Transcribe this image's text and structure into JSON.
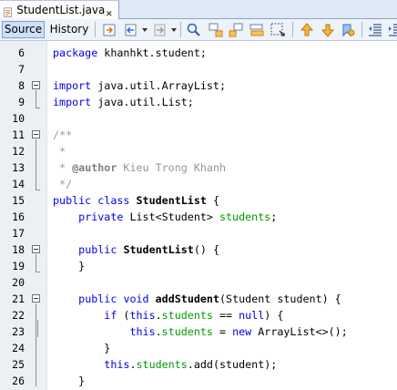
{
  "tab": {
    "filename": "StudentList.java"
  },
  "toolbar": {
    "source_label": "Source",
    "history_label": "History"
  },
  "colors": {
    "keyword": "#0000e6",
    "comment": "#969696",
    "field": "#009900"
  },
  "lines": [
    {
      "num": "6",
      "text": "package khanhkt.student;"
    },
    {
      "num": "7",
      "text": ""
    },
    {
      "num": "8",
      "text": "import java.util.ArrayList;"
    },
    {
      "num": "9",
      "text": "import java.util.List;"
    },
    {
      "num": "10",
      "text": ""
    },
    {
      "num": "11",
      "text": "/**"
    },
    {
      "num": "12",
      "text": " *"
    },
    {
      "num": "13",
      "text": " * @author Kieu Trong Khanh"
    },
    {
      "num": "14",
      "text": " */"
    },
    {
      "num": "15",
      "text": "public class StudentList {"
    },
    {
      "num": "16",
      "text": "    private List<Student> students;"
    },
    {
      "num": "17",
      "text": ""
    },
    {
      "num": "18",
      "text": "    public StudentList() {"
    },
    {
      "num": "19",
      "text": "    }"
    },
    {
      "num": "20",
      "text": ""
    },
    {
      "num": "21",
      "text": "    public void addStudent(Student student) {"
    },
    {
      "num": "22",
      "text": "        if (this.students == null) {"
    },
    {
      "num": "23",
      "text": "            this.students = new ArrayList<>();"
    },
    {
      "num": "24",
      "text": "        }"
    },
    {
      "num": "25",
      "text": "        this.students.add(student);"
    },
    {
      "num": "26",
      "text": "    }"
    }
  ]
}
